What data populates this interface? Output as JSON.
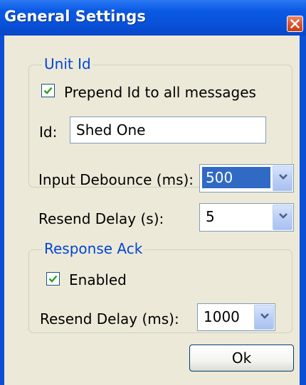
{
  "window": {
    "title": "General Settings",
    "close_icon": "close-icon",
    "colors": {
      "titlebar": "#0950d8",
      "client": "#ece9d8",
      "group_title": "#0046d5",
      "selection": "#316ac5"
    }
  },
  "unit_id_group": {
    "title": "Unit Id",
    "prepend_checkbox": {
      "label": "Prepend Id to all messages",
      "checked": true
    },
    "id_label": "Id:",
    "id_value": "Shed One"
  },
  "input_debounce": {
    "label": "Input Debounce (ms):",
    "value": "500"
  },
  "resend_delay": {
    "label": "Resend Delay (s):",
    "value": "5"
  },
  "response_ack_group": {
    "title": "Response Ack",
    "enabled_checkbox": {
      "label": "Enabled",
      "checked": true
    },
    "resend_delay_label": "Resend Delay (ms):",
    "resend_delay_value": "1000"
  },
  "ok_button_label": "Ok"
}
